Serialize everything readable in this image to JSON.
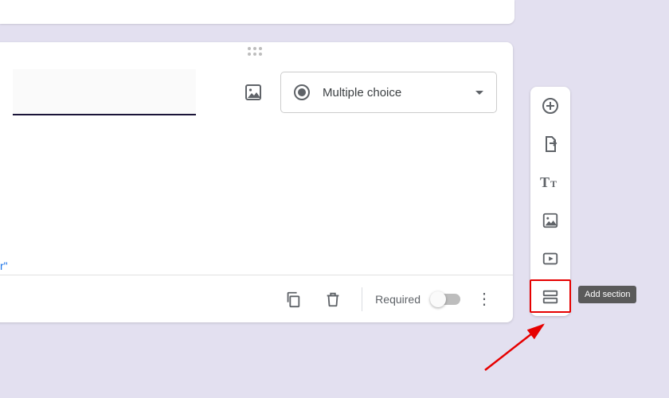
{
  "question": {
    "type_label": "Multiple choice",
    "partial_link_text": "r\""
  },
  "footer": {
    "required_label": "Required",
    "required_on": false
  },
  "side_toolbar": {
    "items": [
      {
        "name": "add-question-icon"
      },
      {
        "name": "import-questions-icon"
      },
      {
        "name": "add-title-icon"
      },
      {
        "name": "add-image-icon"
      },
      {
        "name": "add-video-icon"
      },
      {
        "name": "add-section-icon"
      }
    ],
    "tooltip": "Add section"
  },
  "icons": {
    "more": "⋮"
  }
}
